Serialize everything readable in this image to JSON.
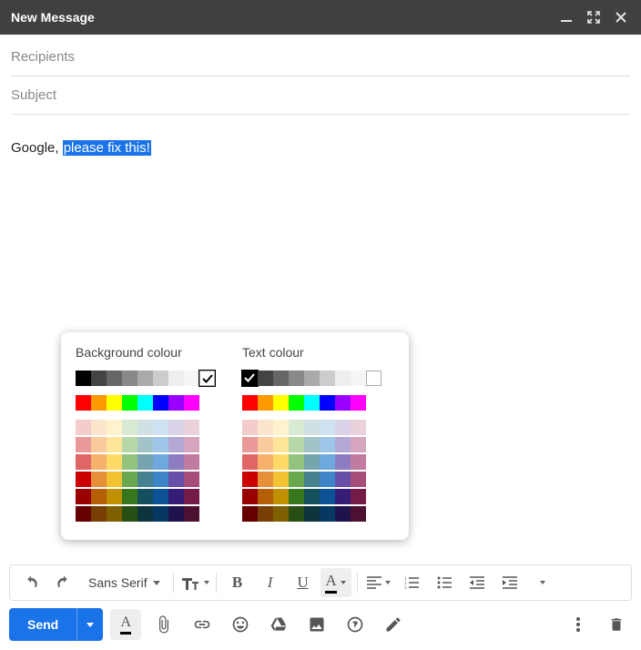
{
  "titlebar": {
    "title": "New Message"
  },
  "fields": {
    "recipients_placeholder": "Recipients",
    "subject_placeholder": "Subject"
  },
  "body": {
    "static_text": "Google, ",
    "selected_text": "please fix this!"
  },
  "color_popup": {
    "bg_label": "Background colour",
    "text_label": "Text colour",
    "grays": [
      "#000000",
      "#444444",
      "#666666",
      "#888888",
      "#aaaaaa",
      "#cccccc",
      "#eeeeee",
      "#f5f5f5",
      "#ffffff"
    ],
    "brights": [
      "#ff0000",
      "#ff9900",
      "#ffff00",
      "#00ff00",
      "#00ffff",
      "#0000ff",
      "#9900ff",
      "#ff00ff"
    ],
    "muted": [
      [
        "#f4cccc",
        "#fce5cd",
        "#fff2cc",
        "#d9ead3",
        "#d0e0e3",
        "#cfe2f3",
        "#d9d2e9",
        "#ead1dc"
      ],
      [
        "#ea9999",
        "#f9cb9c",
        "#ffe599",
        "#b6d7a8",
        "#a2c4c9",
        "#9fc5e8",
        "#b4a7d6",
        "#d5a6bd"
      ],
      [
        "#e06666",
        "#f6b26b",
        "#ffd966",
        "#93c47d",
        "#76a5af",
        "#6fa8dc",
        "#8e7cc3",
        "#c27ba0"
      ],
      [
        "#cc0000",
        "#e69138",
        "#f1c232",
        "#6aa84f",
        "#45818e",
        "#3d85c6",
        "#674ea7",
        "#a64d79"
      ],
      [
        "#990000",
        "#b45f06",
        "#bf9000",
        "#38761d",
        "#134f5c",
        "#0b5394",
        "#351c75",
        "#741b47"
      ],
      [
        "#660000",
        "#783f04",
        "#7f6000",
        "#274e13",
        "#0c343d",
        "#073763",
        "#20124d",
        "#4c1130"
      ]
    ],
    "bg_selected_index": 8,
    "text_selected_index": 0
  },
  "format_bar": {
    "font_label": "Sans Serif"
  },
  "bottom_bar": {
    "send_label": "Send"
  }
}
